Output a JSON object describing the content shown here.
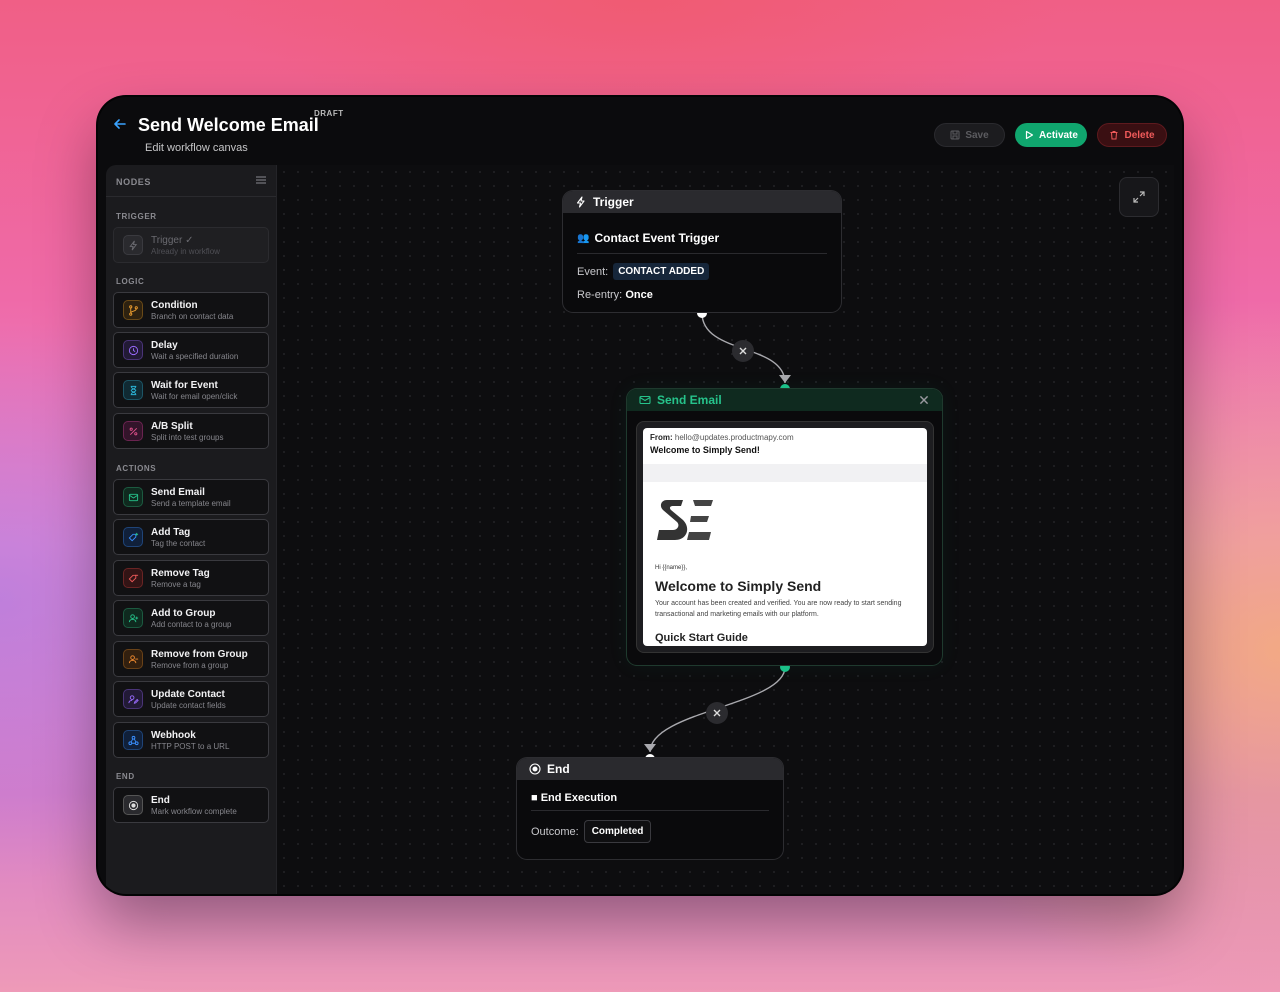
{
  "header": {
    "title": "Send Welcome Email",
    "badge": "DRAFT",
    "subtitle": "Edit workflow canvas",
    "save_label": "Save",
    "activate_label": "Activate",
    "delete_label": "Delete"
  },
  "sidebar": {
    "title": "NODES",
    "sections": {
      "trigger": "TRIGGER",
      "logic": "LOGIC",
      "actions": "ACTIONS",
      "end": "END"
    },
    "trigger_item": {
      "label": "Trigger ✓",
      "desc": "Already in workflow"
    },
    "logic_items": [
      {
        "label": "Condition",
        "desc": "Branch on contact data",
        "icon": "branch-icon",
        "color": "#f0a030"
      },
      {
        "label": "Delay",
        "desc": "Wait a specified duration",
        "icon": "clock-icon",
        "color": "#9a6bff"
      },
      {
        "label": "Wait for Event",
        "desc": "Wait for email open/click",
        "icon": "hourglass-icon",
        "color": "#2bb3d6"
      },
      {
        "label": "A/B Split",
        "desc": "Split into test groups",
        "icon": "percent-icon",
        "color": "#e0508a"
      }
    ],
    "action_items": [
      {
        "label": "Send Email",
        "desc": "Send a template email",
        "icon": "mail-icon",
        "color": "#26c38b"
      },
      {
        "label": "Add Tag",
        "desc": "Tag the contact",
        "icon": "tag-plus-icon",
        "color": "#3a8fff"
      },
      {
        "label": "Remove Tag",
        "desc": "Remove a tag",
        "icon": "tag-minus-icon",
        "color": "#ef5a5a"
      },
      {
        "label": "Add to Group",
        "desc": "Add contact to a group",
        "icon": "user-plus-icon",
        "color": "#26c38b"
      },
      {
        "label": "Remove from Group",
        "desc": "Remove from a group",
        "icon": "user-minus-icon",
        "color": "#f08a30"
      },
      {
        "label": "Update Contact",
        "desc": "Update contact fields",
        "icon": "user-edit-icon",
        "color": "#9a6bff"
      },
      {
        "label": "Webhook",
        "desc": "HTTP POST to a URL",
        "icon": "webhook-icon",
        "color": "#3a8fff"
      }
    ],
    "end_item": {
      "label": "End",
      "desc": "Mark workflow complete",
      "icon": "target-icon",
      "color": "#cccccc"
    }
  },
  "canvas": {
    "trigger": {
      "title": "Trigger",
      "name": "Contact Event Trigger",
      "event_label": "Event:",
      "event_value": "CONTACT ADDED",
      "reentry_label": "Re-entry:",
      "reentry_value": "Once"
    },
    "send_email": {
      "title": "Send Email",
      "from_label": "From:",
      "from_value": "hello@updates.productmapy.com",
      "subject": "Welcome to Simply Send!",
      "greeting": "Hi {{name}},",
      "heading": "Welcome to Simply Send",
      "body": "Your account has been created and verified. You are now ready to start sending transactional and marketing emails with our platform.",
      "subheading": "Quick Start Guide"
    },
    "end": {
      "title": "End",
      "name": "■ End Execution",
      "outcome_label": "Outcome:",
      "outcome_value": "Completed"
    }
  },
  "colors": {
    "accent_green": "#10a66e",
    "danger": "#ef5a5a",
    "link_blue": "#3aa3ff"
  }
}
